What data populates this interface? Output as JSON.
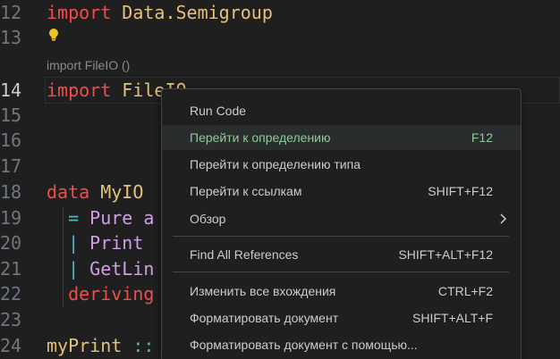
{
  "editor": {
    "lines": [
      {
        "num": "12",
        "tokens": [
          {
            "t": "import ",
            "c": "kw"
          },
          {
            "t": "Data.Semigroup",
            "c": "mod"
          }
        ]
      },
      {
        "num": "13",
        "tokens": []
      },
      {
        "num": "14",
        "tokens": [
          {
            "t": "import ",
            "c": "kw"
          },
          {
            "t": "FileIO",
            "c": "mod"
          }
        ]
      },
      {
        "num": "15",
        "tokens": []
      },
      {
        "num": "16",
        "tokens": []
      },
      {
        "num": "17",
        "tokens": []
      },
      {
        "num": "18",
        "tokens": [
          {
            "t": "data ",
            "c": "kw"
          },
          {
            "t": "MyIO",
            "c": "typ"
          }
        ]
      },
      {
        "num": "19",
        "tokens": [
          {
            "t": "  = ",
            "c": "op"
          },
          {
            "t": "Pure a",
            "c": "ctor"
          }
        ]
      },
      {
        "num": "20",
        "tokens": [
          {
            "t": "  | ",
            "c": "op"
          },
          {
            "t": "Print",
            "c": "ctor"
          }
        ]
      },
      {
        "num": "21",
        "tokens": [
          {
            "t": "  | ",
            "c": "op"
          },
          {
            "t": "GetLin",
            "c": "ctor"
          }
        ]
      },
      {
        "num": "22",
        "tokens": [
          {
            "t": "  deriving",
            "c": "kw"
          }
        ]
      },
      {
        "num": "23",
        "tokens": []
      },
      {
        "num": "24",
        "tokens": [
          {
            "t": "myPrint ",
            "c": "fn"
          },
          {
            "t": "::",
            "c": "op"
          }
        ]
      }
    ],
    "codelens": "import FileIO ()",
    "lightbulb_icon": "lightbulb-icon"
  },
  "context_menu": {
    "items": [
      {
        "label": "Run Code",
        "key": ""
      },
      {
        "label": "Перейти к определению",
        "key": "F12",
        "highlighted": true
      },
      {
        "label": "Перейти к определению типа",
        "key": ""
      },
      {
        "label": "Перейти к ссылкам",
        "key": "SHIFT+F12"
      },
      {
        "label": "Обзор",
        "key": "",
        "submenu": true
      },
      {
        "label": "Find All References",
        "key": "SHIFT+ALT+F12"
      },
      {
        "label": "Изменить все вхождения",
        "key": "CTRL+F2"
      },
      {
        "label": "Форматировать документ",
        "key": "SHIFT+ALT+F"
      },
      {
        "label": "Форматировать документ с помощью...",
        "key": ""
      }
    ],
    "highlight_color": "#8fc99a",
    "chevron_icon": "chevron-right-icon"
  }
}
